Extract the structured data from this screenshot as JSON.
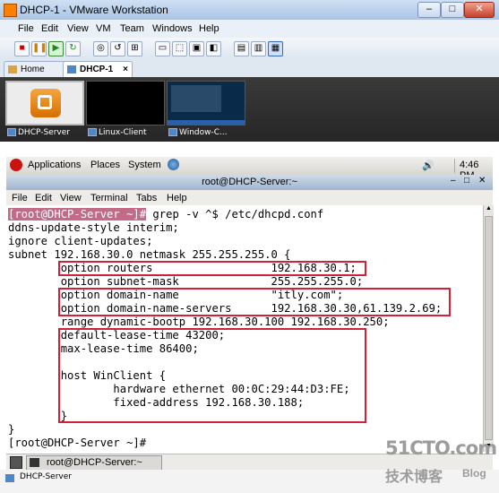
{
  "vmware": {
    "window_title": "DHCP-1 - VMware Workstation",
    "menu": [
      "File",
      "Edit",
      "View",
      "VM",
      "Team",
      "Windows",
      "Help"
    ],
    "tabs": [
      {
        "label": "Home",
        "close": "×"
      },
      {
        "label": "DHCP-1",
        "close": "×"
      }
    ],
    "thumbnails": [
      {
        "label": "DHCP-Server"
      },
      {
        "label": "Linux-Client"
      },
      {
        "label": "Window-C..."
      }
    ]
  },
  "gnome": {
    "menu": [
      "Applications",
      "Places",
      "System"
    ],
    "clock": "4:46 PM"
  },
  "terminal": {
    "window_title": "root@DHCP-Server:~",
    "menu": [
      "File",
      "Edit",
      "View",
      "Terminal",
      "Tabs",
      "Help"
    ],
    "prompt": "[root@DHCP-Server ~]#",
    "command": " grep -v ^$ /etc/dhcpd.conf",
    "output": [
      "ddns-update-style interim;",
      "ignore client-updates;",
      "subnet 192.168.30.0 netmask 255.255.255.0 {",
      "        option routers                  192.168.30.1;",
      "        option subnet-mask              255.255.255.0;",
      "        option domain-name              \"itly.com\";",
      "        option domain-name-servers      192.168.30.30,61.139.2.69;",
      "        range dynamic-bootp 192.168.30.100 192.168.30.250;",
      "        default-lease-time 43200;",
      "        max-lease-time 86400;",
      "",
      "        host WinClient {",
      "                hardware ethernet 00:0C:29:44:D3:FE;",
      "                fixed-address 192.168.30.188;",
      "        }",
      "}"
    ],
    "final_prompt": "[root@DHCP-Server ~]#"
  },
  "taskbar": {
    "item": "root@DHCP-Server:~"
  },
  "statusbar": {
    "label": "DHCP-Server"
  },
  "watermark": {
    "line1": "51CTO.com",
    "line2": "技术博客",
    "line3": "Blog"
  },
  "colors": {
    "highlight_box": "#d0213a",
    "prompt_highlight": "#c26a86"
  }
}
